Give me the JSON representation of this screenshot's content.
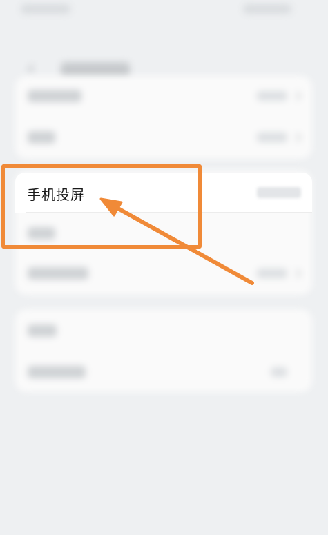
{
  "screen": {
    "highlighted_item": {
      "label": "手机投屏"
    }
  },
  "annotation": {
    "color": "#f08a38"
  }
}
